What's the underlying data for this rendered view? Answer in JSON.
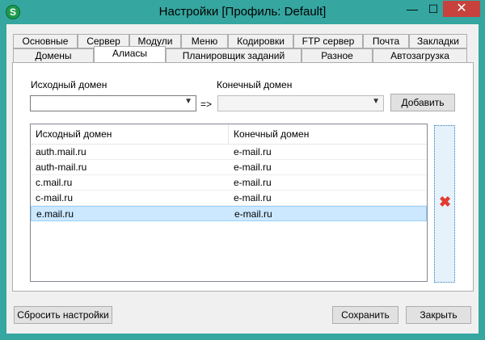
{
  "window": {
    "title": "Настройки [Профиль: Default]",
    "app_icon_letter": "S",
    "minimize_glyph": "—",
    "maximize_glyph": "☐",
    "close_glyph": "✕"
  },
  "tabs_row1": [
    "Основные",
    "Сервер",
    "Модули",
    "Меню",
    "Кодировки",
    "FTP сервер",
    "Почта",
    "Закладки"
  ],
  "tabs_row2": [
    "Домены",
    "Алиасы",
    "Планировщик заданий",
    "Разное",
    "Автозагрузка"
  ],
  "active_tab": "Алиасы",
  "form": {
    "source_label": "Исходный домен",
    "target_label": "Конечный домен",
    "source_value": "",
    "target_value": "",
    "arrow_text": "=>",
    "add_button": "Добавить"
  },
  "table": {
    "columns": [
      "Исходный домен",
      "Конечный домен"
    ],
    "rows": [
      [
        "auth.mail.ru",
        "e-mail.ru"
      ],
      [
        "auth-mail.ru",
        "e-mail.ru"
      ],
      [
        "c.mail.ru",
        "e-mail.ru"
      ],
      [
        "c-mail.ru",
        "e-mail.ru"
      ],
      [
        "e.mail.ru",
        "e-mail.ru"
      ]
    ],
    "selected_row": 4
  },
  "footer": {
    "reset_button": "Сбросить настройки",
    "save_button": "Сохранить",
    "close_button": "Закрыть"
  },
  "colors": {
    "accent": "#35a6a0",
    "close_red": "#c7423d",
    "delete_icon": "#e33b2f",
    "selection": "#cce8ff"
  }
}
